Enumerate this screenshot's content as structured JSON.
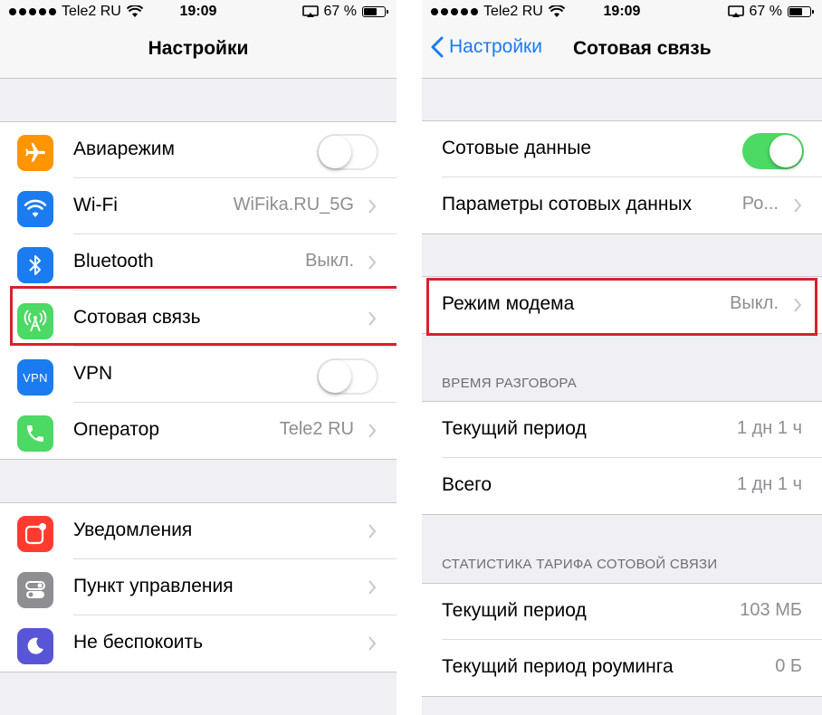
{
  "status_bar": {
    "carrier": "Tele2 RU",
    "time": "19:09",
    "battery": "67 %",
    "battery_level": 0.67
  },
  "left": {
    "nav": {
      "title": "Настройки"
    },
    "group1": [
      {
        "label": "Авиарежим",
        "icon": "airplane-icon",
        "icon_color": "#ff9500",
        "toggle": false
      },
      {
        "label": "Wi-Fi",
        "value": "WiFika.RU_5G",
        "icon": "wifi-icon",
        "icon_color": "#1a7cf0"
      },
      {
        "label": "Bluetooth",
        "value": "Выкл.",
        "icon": "bluetooth-icon",
        "icon_color": "#1a7cf0"
      },
      {
        "label": "Сотовая связь",
        "icon": "cellular-antenna-icon",
        "icon_color": "#4cd964"
      },
      {
        "label": "VPN",
        "icon_text": "VPN",
        "icon": "vpn-icon",
        "icon_color": "#1a7cf0",
        "toggle": false
      },
      {
        "label": "Оператор",
        "value": "Tele2 RU",
        "icon": "phone-icon",
        "icon_color": "#4cd964"
      }
    ],
    "group2": [
      {
        "label": "Уведомления",
        "icon": "notifications-icon",
        "icon_color": "#ff3b30"
      },
      {
        "label": "Пункт управления",
        "icon": "control-center-icon",
        "icon_color": "#8e8e93"
      },
      {
        "label": "Не беспокоить",
        "icon": "moon-icon",
        "icon_color": "#5856d6"
      }
    ]
  },
  "right": {
    "nav": {
      "back_label": "Настройки",
      "title": "Сотовая связь"
    },
    "group1": [
      {
        "label": "Сотовые данные",
        "toggle": true
      },
      {
        "label": "Параметры сотовых данных",
        "value": "Ро..."
      }
    ],
    "group2": [
      {
        "label": "Режим модема",
        "value": "Выкл."
      }
    ],
    "section_call_time": "ВРЕМЯ РАЗГОВОРА",
    "group3": [
      {
        "label": "Текущий период",
        "value": "1 дн 1 ч"
      },
      {
        "label": "Всего",
        "value": "1 дн 1 ч"
      }
    ],
    "section_tariff": "СТАТИСТИКА ТАРИФА СОТОВОЙ СВЯЗИ",
    "group4": [
      {
        "label": "Текущий период",
        "value": "103 МБ"
      },
      {
        "label": "Текущий период роуминга",
        "value": "0 Б"
      }
    ]
  },
  "colors": {
    "accent": "#1a7cf0",
    "toggle_on": "#4cd964",
    "highlight": "#d8212a"
  }
}
